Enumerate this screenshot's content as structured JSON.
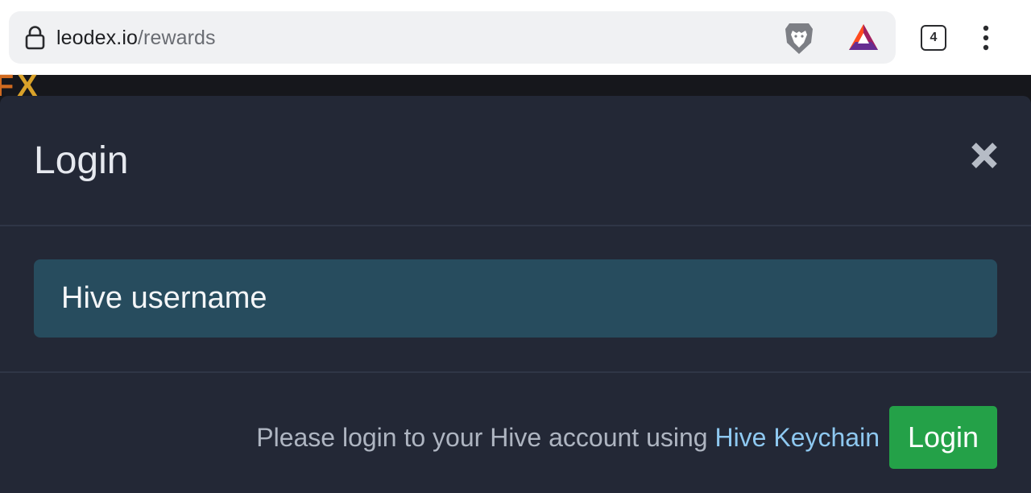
{
  "browser": {
    "url_host": "leodex.io",
    "url_path": "/rewards",
    "tab_count": "4",
    "icons": [
      "lock-icon",
      "brave-lion-icon",
      "bat-rewards-icon",
      "overflow-menu-icon"
    ]
  },
  "page": {
    "logo_partial": {
      "f": "F",
      "x": "X"
    }
  },
  "modal": {
    "title": "Login",
    "close_icon": "close-icon",
    "username_placeholder": "Hive username",
    "footer_text": "Please login to your Hive account using ",
    "footer_link": "Hive Keychain",
    "login_label": "Login"
  },
  "colors": {
    "modal_bg": "#232836",
    "input_bg": "#274c5e",
    "login_button": "#24a148",
    "link": "#8ec8f0"
  }
}
